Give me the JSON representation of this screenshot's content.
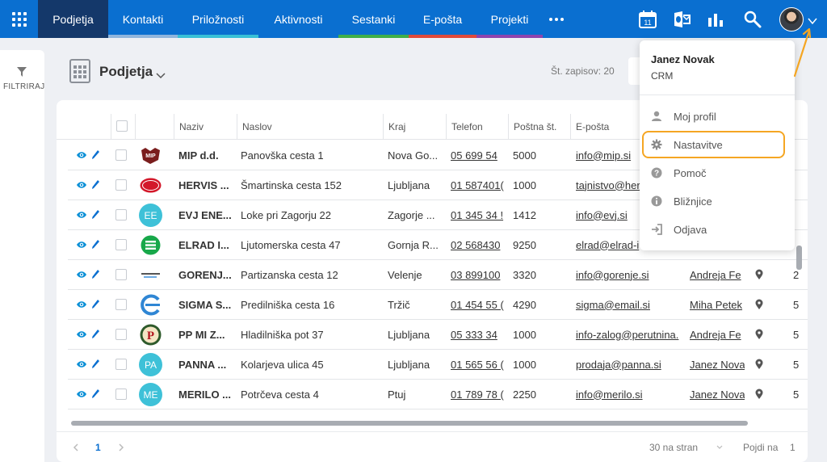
{
  "nav": {
    "tabs": [
      {
        "label": "Podjetja",
        "bar": "#14386a"
      },
      {
        "label": "Kontakti",
        "bar": "#90b5dc"
      },
      {
        "label": "Priložnosti",
        "bar": "#39c0d6"
      },
      {
        "label": "Aktivnosti",
        "bar": "#0a6fd0"
      },
      {
        "label": "Sestanki",
        "bar": "#3fae49"
      },
      {
        "label": "E-pošta",
        "bar": "#e04a3a"
      },
      {
        "label": "Projekti",
        "bar": "#8e44ad"
      }
    ],
    "calendar_day": "11",
    "icons": [
      "apps-icon",
      "more-icon",
      "calendar-icon",
      "outlook-icon",
      "chart-icon",
      "search-icon",
      "avatar",
      "chevron-down-icon"
    ]
  },
  "sidebar": {
    "filter_label": "FILTRIRAJ"
  },
  "page": {
    "title": "Podjetja",
    "record_count": "Št. zapisov: 20"
  },
  "table": {
    "columns": [
      "Naziv",
      "Naslov",
      "Kraj",
      "Telefon",
      "Poštna št.",
      "E-pošta"
    ],
    "rows": [
      {
        "logo": "mip",
        "name": "MIP d.d.",
        "address": "Panovška cesta 1",
        "city": "Nova Go...",
        "phone": "05 699 54",
        "zip": "5000",
        "email": "info@mip.si",
        "contact": "",
        "extra": ""
      },
      {
        "logo": "hervis",
        "name": "HERVIS ...",
        "address": "Šmartinska cesta 152",
        "city": "Ljubljana",
        "phone": "01 587401(",
        "zip": "1000",
        "email": "tajnistvo@her",
        "contact": "",
        "extra": ""
      },
      {
        "logo": "EE",
        "name": "EVJ ENE...",
        "address": "Loke pri Zagorju 22",
        "city": "Zagorje ...",
        "phone": "01 345 34 !",
        "zip": "1412",
        "email": "info@evj.si",
        "contact": "",
        "extra": ""
      },
      {
        "logo": "elrad",
        "name": "ELRAD I...",
        "address": "Ljutomerska cesta 47",
        "city": "Gornja R...",
        "phone": "02 568430",
        "zip": "9250",
        "email": "elrad@elrad-i",
        "contact": "",
        "extra": ""
      },
      {
        "logo": "gorenje",
        "name": "GORENJ...",
        "address": "Partizanska cesta 12",
        "city": "Velenje",
        "phone": "03 899100",
        "zip": "3320",
        "email": "info@gorenje.si",
        "contact": "Andreja Fe",
        "extra": "2"
      },
      {
        "logo": "sigma",
        "name": "SIGMA S...",
        "address": "Predilniška cesta 16",
        "city": "Tržič",
        "phone": "01 454 55 (",
        "zip": "4290",
        "email": "sigma@email.si",
        "contact": "Miha Petek",
        "extra": "5"
      },
      {
        "logo": "pp",
        "name": "PP MI Z...",
        "address": "Hladilniška pot 37",
        "city": "Ljubljana",
        "phone": "05 333 34",
        "zip": "1000",
        "email": "info-zalog@perutnina.",
        "contact": "Andreja Fe",
        "extra": "5"
      },
      {
        "logo": "PA",
        "name": "PANNA ...",
        "address": "Kolarjeva ulica 45",
        "city": "Ljubljana",
        "phone": "01 565 56 (",
        "zip": "1000",
        "email": "prodaja@panna.si",
        "contact": "Janez Nova",
        "extra": "5"
      },
      {
        "logo": "ME",
        "name": "MERILO ...",
        "address": "Potrčeva cesta 4",
        "city": "Ptuj",
        "phone": "01 789 78 (",
        "zip": "2250",
        "email": "info@merilo.si",
        "contact": "Janez Nova",
        "extra": "5"
      }
    ]
  },
  "footer": {
    "page": "1",
    "per_page": "30 na stran",
    "goto_label": "Pojdi na",
    "goto_value": "1"
  },
  "user_menu": {
    "name": "Janez Novak",
    "subtitle": "CRM",
    "items": [
      {
        "label": "Moj profil",
        "icon": "user-icon"
      },
      {
        "label": "Nastavitve",
        "icon": "gear-icon"
      },
      {
        "label": "Pomoč",
        "icon": "help-icon"
      },
      {
        "label": "Bližnjice",
        "icon": "info-icon"
      },
      {
        "label": "Odjava",
        "icon": "logout-icon"
      }
    ]
  },
  "colors": {
    "nav": "#0a6fd0",
    "nav_active": "#14386a",
    "highlight": "#f5a623",
    "avatar_circle": "#3ec1d8"
  }
}
